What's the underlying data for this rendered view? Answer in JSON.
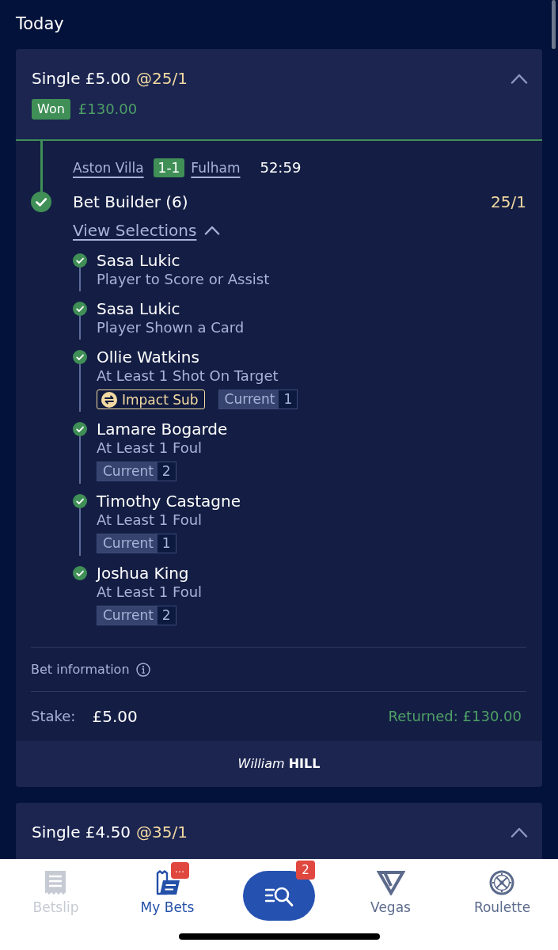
{
  "section_title": "Today",
  "bets": [
    {
      "summary": "Single £5.00",
      "odds": "@25/1",
      "expanded": true,
      "status": {
        "kind": "won",
        "label": "Won",
        "amount": "£130.00"
      },
      "event": {
        "home": "Aston Villa",
        "score": "1-1",
        "away": "Fulham",
        "clock": "52:59"
      },
      "market": {
        "name": "Bet Builder (6)",
        "odds": "25/1",
        "won": true
      },
      "view_selections": {
        "label": "View Selections",
        "expanded": true
      },
      "selections": [
        {
          "player": "Sasa Lukic",
          "market": "Player to Score or Assist",
          "won": true
        },
        {
          "player": "Sasa Lukic",
          "market": "Player Shown a Card",
          "won": true
        },
        {
          "player": "Ollie Watkins",
          "market": "At Least 1 Shot On Target",
          "won": true,
          "tags": [
            {
              "kind": "impact_sub",
              "label": "Impact Sub"
            },
            {
              "kind": "current",
              "label": "Current",
              "value": "1"
            }
          ]
        },
        {
          "player": "Lamare Bogarde",
          "market": "At Least 1 Foul",
          "won": true,
          "tags": [
            {
              "kind": "current",
              "label": "Current",
              "value": "2"
            }
          ]
        },
        {
          "player": "Timothy Castagne",
          "market": "At Least 1 Foul",
          "won": true,
          "tags": [
            {
              "kind": "current",
              "label": "Current",
              "value": "1"
            }
          ]
        },
        {
          "player": "Joshua King",
          "market": "At Least 1 Foul",
          "won": true,
          "tags": [
            {
              "kind": "current",
              "label": "Current",
              "value": "2"
            }
          ]
        }
      ],
      "bet_information": "Bet information",
      "stake_label": "Stake:",
      "stake": "£5.00",
      "returned": "Returned: £130.00",
      "brand": "*William* **HILL**"
    },
    {
      "summary": "Single £4.50",
      "odds": "@35/1",
      "expanded": true
    }
  ],
  "nav": {
    "items": [
      {
        "kind": "tab",
        "label": "Betslip",
        "selected": false,
        "disabled": true
      },
      {
        "kind": "tab",
        "label": "My Bets",
        "selected": true,
        "disabled": false,
        "badge": "..."
      },
      {
        "kind": "search",
        "selected": false,
        "disabled": false,
        "badge": "2"
      },
      {
        "kind": "tab",
        "label": "Vegas",
        "selected": false,
        "disabled": false
      },
      {
        "kind": "tab",
        "label": "Roulette",
        "selected": false,
        "disabled": false
      }
    ]
  }
}
